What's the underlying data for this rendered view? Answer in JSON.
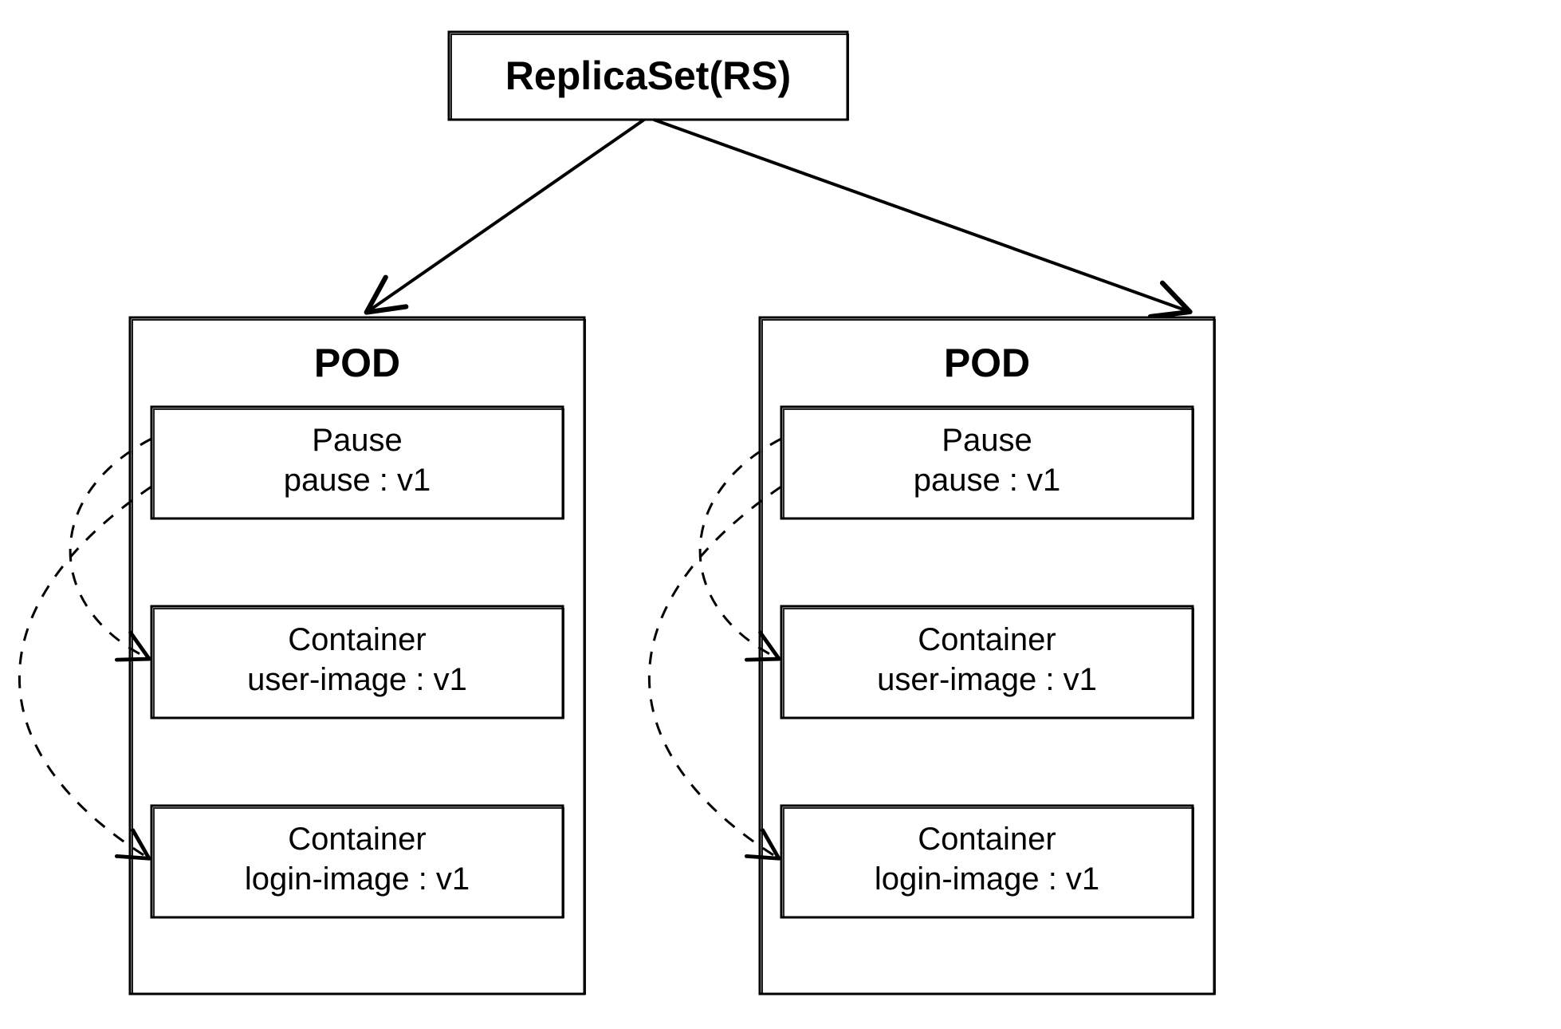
{
  "title": "ReplicaSet(RS)",
  "pods": [
    {
      "title": "POD",
      "containers": [
        {
          "name": "Pause",
          "image": "pause : v1"
        },
        {
          "name": "Container",
          "image": "user-image : v1"
        },
        {
          "name": "Container",
          "image": "login-image : v1"
        }
      ]
    },
    {
      "title": "POD",
      "containers": [
        {
          "name": "Pause",
          "image": "pause : v1"
        },
        {
          "name": "Container",
          "image": "user-image : v1"
        },
        {
          "name": "Container",
          "image": "login-image : v1"
        }
      ]
    }
  ]
}
